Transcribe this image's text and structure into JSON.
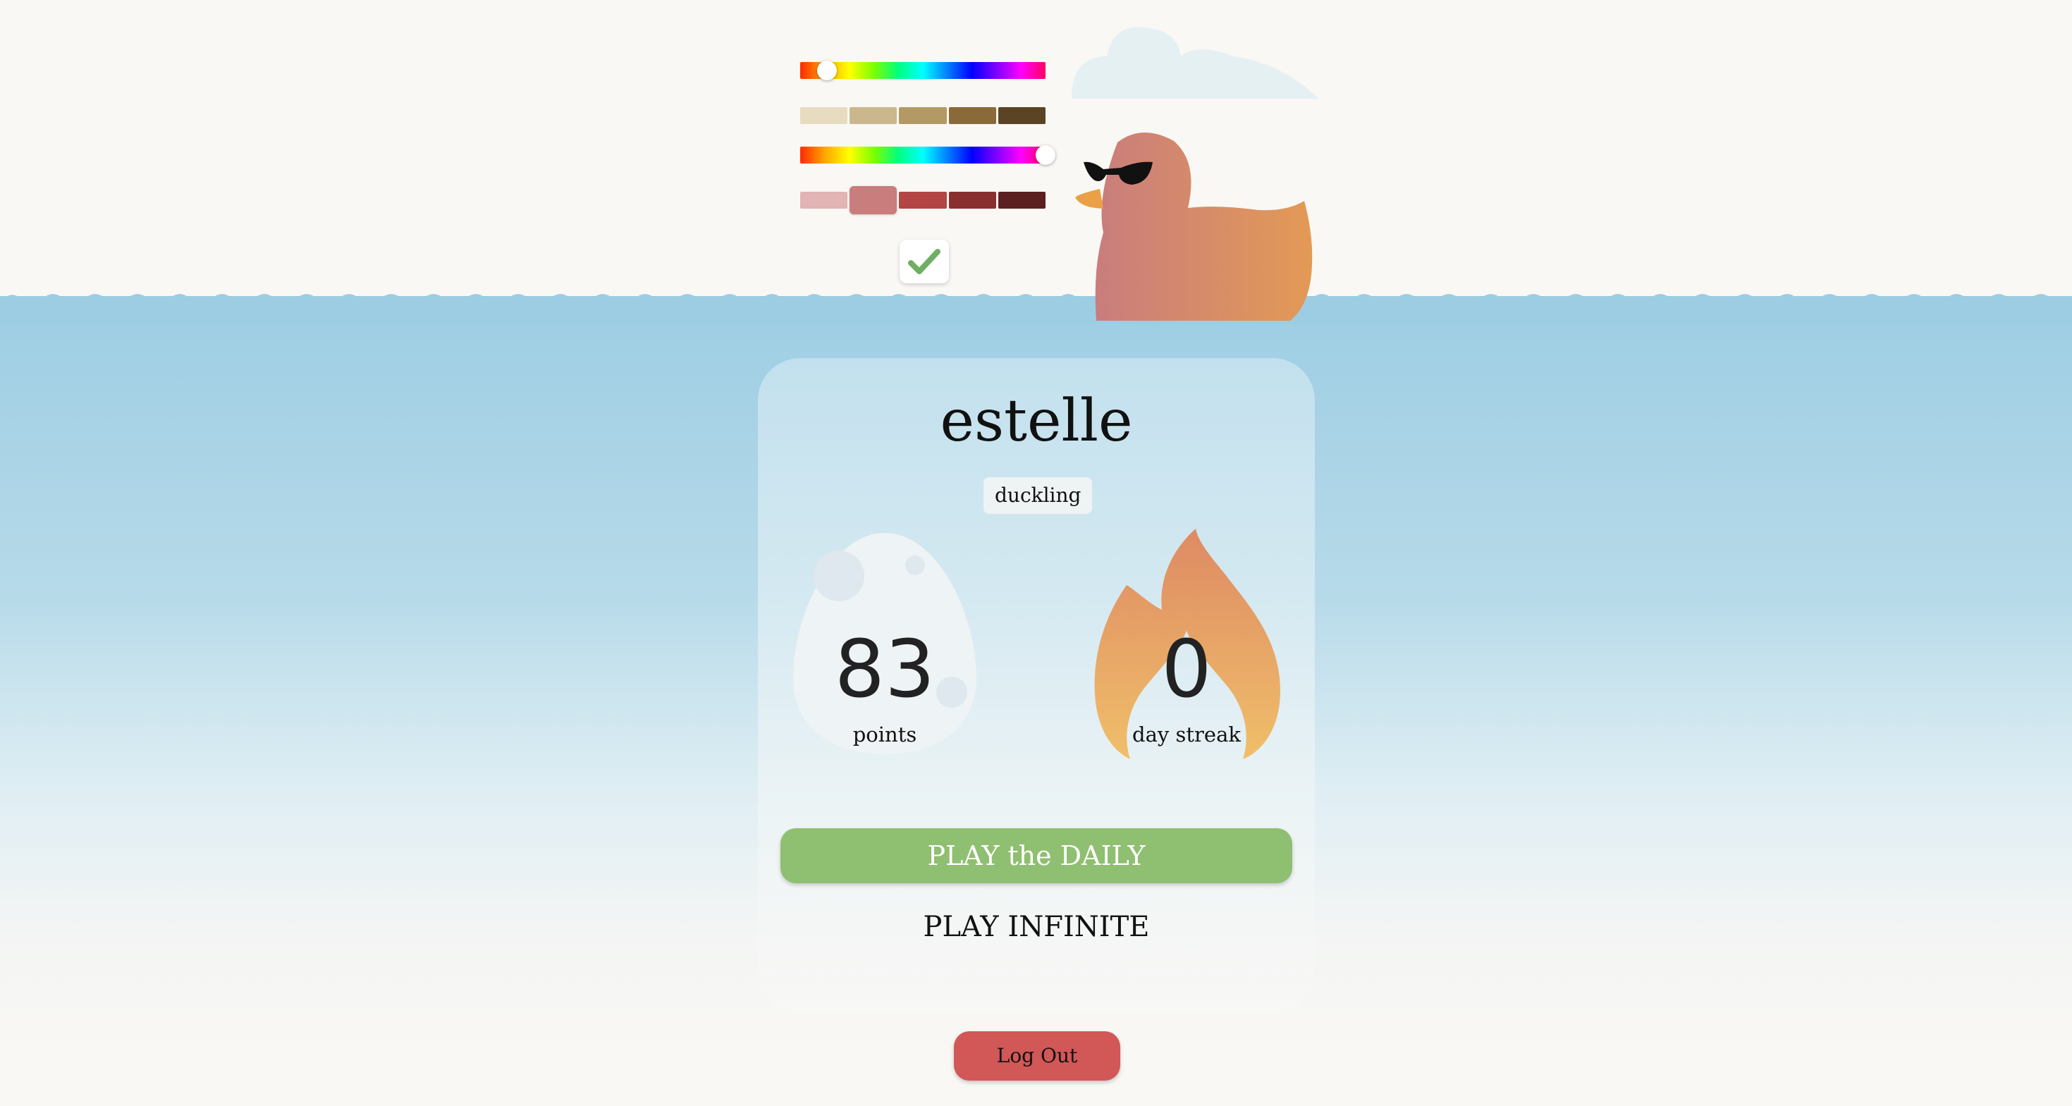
{
  "profile": {
    "username": "estelle",
    "rank": "duckling",
    "points_value": "83",
    "points_label": "points",
    "streak_value": "0",
    "streak_label": "day streak"
  },
  "actions": {
    "play_daily": "PLAY the DAILY",
    "play_infinite": "PLAY INFINITE",
    "log_out": "Log Out"
  },
  "customizer": {
    "hue_slider_1_level": 0.11,
    "hue_slider_2_level": 1.0,
    "shades_1": [
      "#e8dcc0",
      "#cbb78d",
      "#b39a64",
      "#8a6a38",
      "#5b4423"
    ],
    "shades_2": [
      "#e2b4b4",
      "#c97d7d",
      "#b34545",
      "#8a2f2f",
      "#5c1f1f"
    ],
    "shades_2_selected": 1,
    "confirm_icon": "check-icon"
  },
  "colors": {
    "duck_body_start": "#c97d7d",
    "duck_body_end": "#e39a55",
    "play_daily": "#8fbf70",
    "log_out": "#d25757",
    "water": "#9dcde3"
  }
}
